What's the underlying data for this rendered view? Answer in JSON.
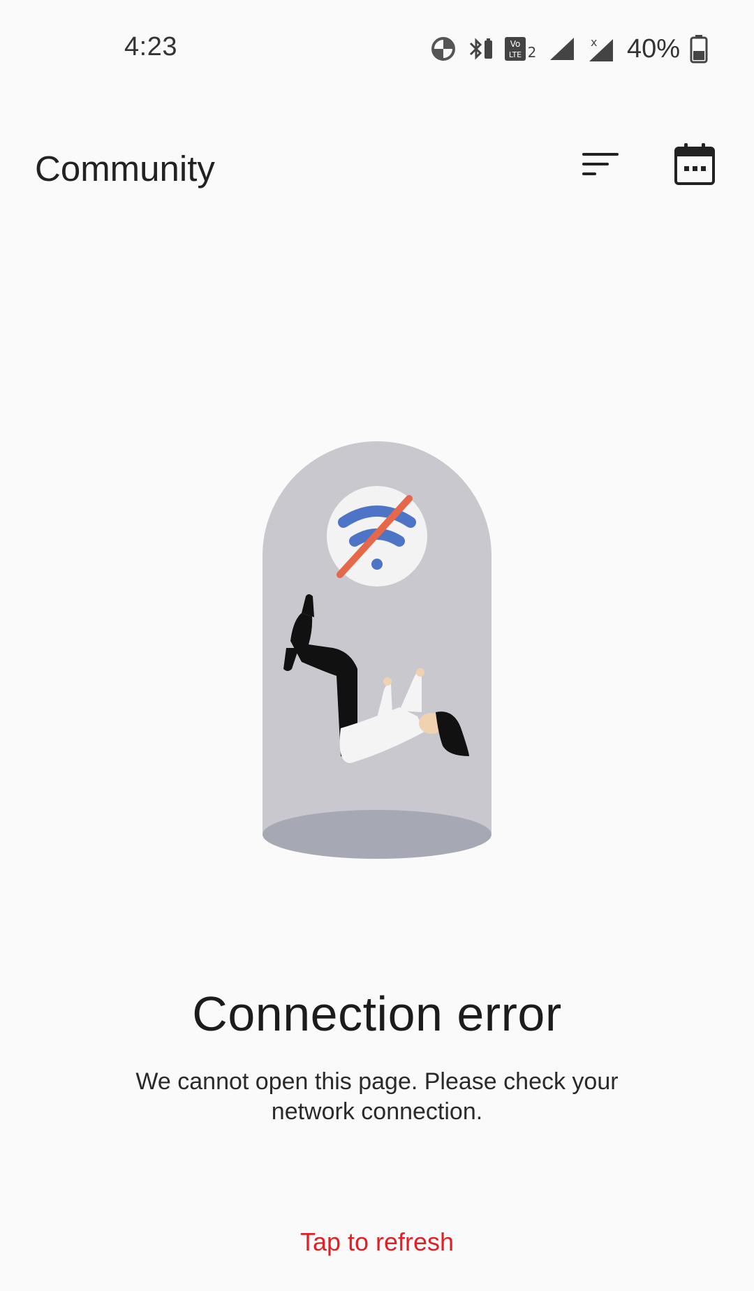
{
  "status_bar": {
    "time": "4:23",
    "battery_percent": "40%",
    "icons": [
      "data-saver-icon",
      "bluetooth-icon",
      "volte-lte2-icon",
      "signal-icon",
      "signal-no-service-icon",
      "battery-icon"
    ],
    "volte_label_top": "Vo",
    "volte_label_bottom": "LTE",
    "sim_number": "2",
    "no_service_mark": "x"
  },
  "header": {
    "title": "Community",
    "sort_icon": "sort-icon",
    "calendar_icon": "calendar-icon"
  },
  "error": {
    "title": "Connection error",
    "message": "We cannot open this page. Please check your network connection.",
    "refresh_label": "Tap to refresh"
  },
  "colors": {
    "background": "#fafafa",
    "accent_red": "#e02026",
    "wifi_blue": "#4e74c8",
    "slash_orange": "#e5684a",
    "capsule_gray": "#c9c9cf"
  }
}
